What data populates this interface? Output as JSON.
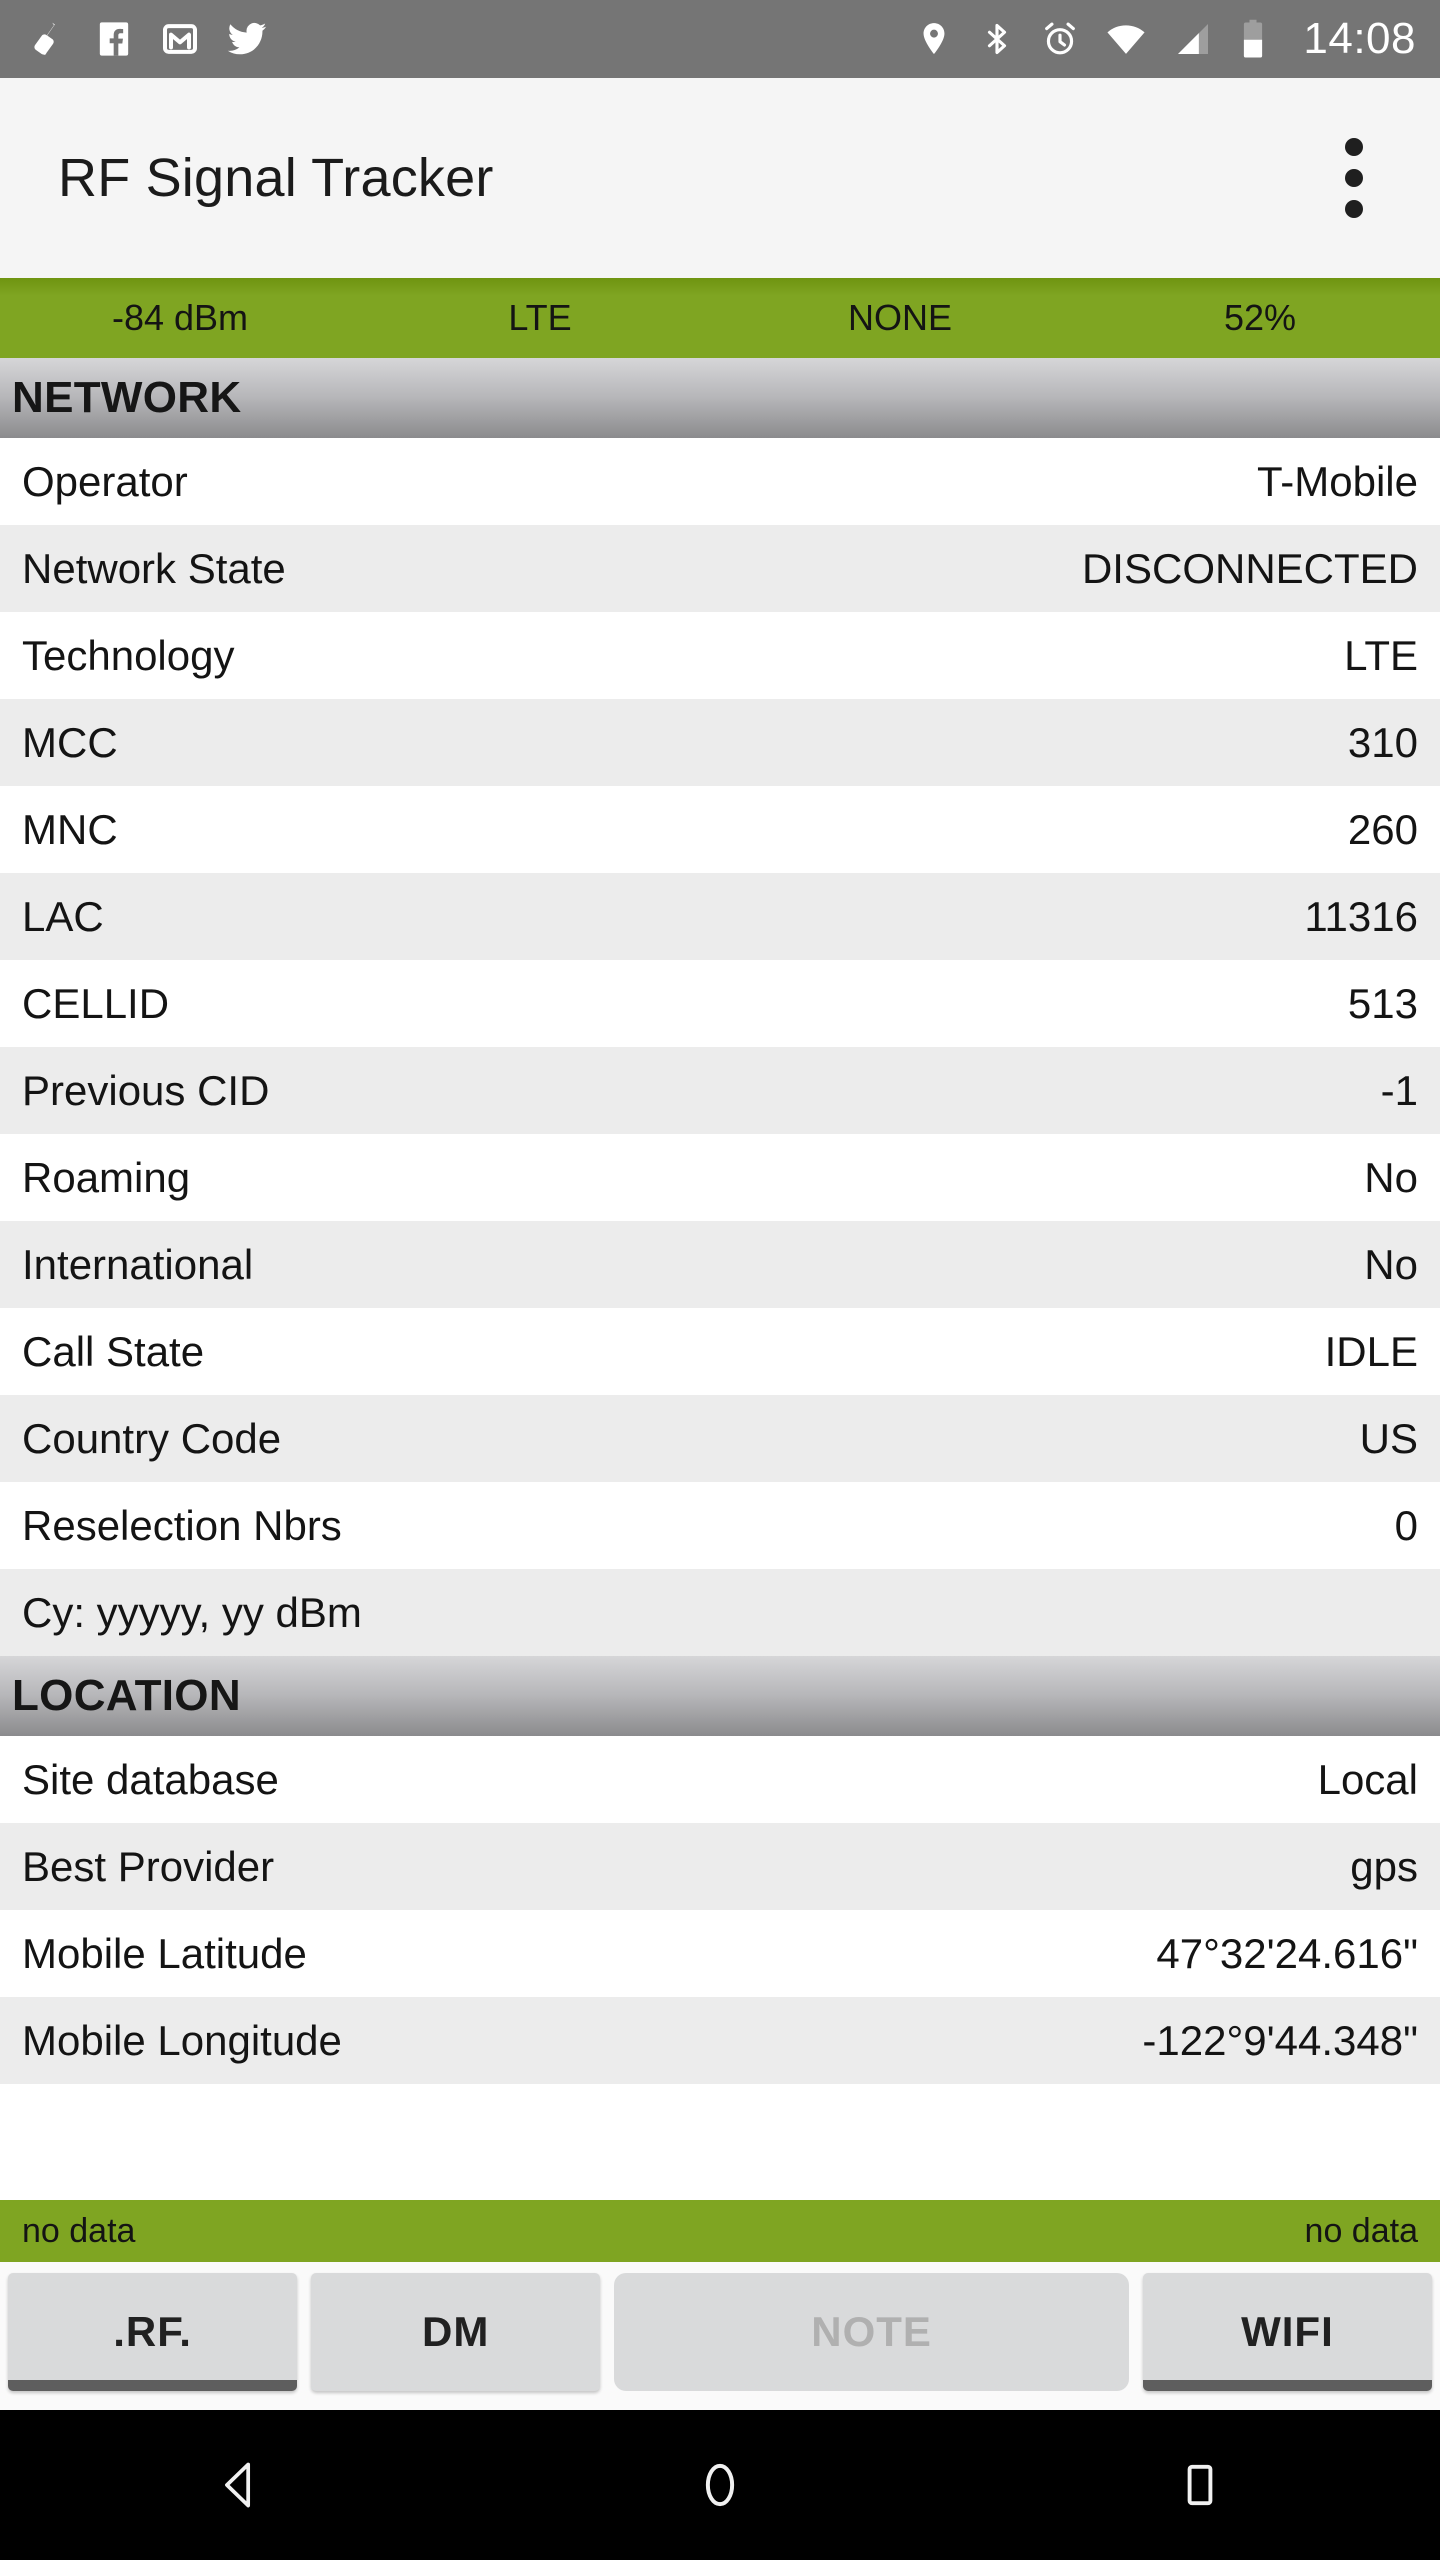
{
  "statusbar": {
    "left_icons": [
      "cleaner-icon",
      "facebook-icon",
      "gmail-icon",
      "twitter-icon"
    ],
    "right_icons": [
      "location-icon",
      "bluetooth-icon",
      "alarm-icon",
      "wifi-icon",
      "cellular-signal-icon",
      "battery-icon"
    ],
    "clock": "14:08",
    "background": "#757575"
  },
  "appbar": {
    "title": "RF Signal Tracker",
    "overflow_label": "More options",
    "background": "#f5f5f5"
  },
  "summary": {
    "accent": "#7fa522",
    "cells": [
      "-84 dBm",
      "LTE",
      "NONE",
      "52%"
    ]
  },
  "sections": [
    {
      "title": "NETWORK",
      "rows": [
        {
          "key": "Operator",
          "value": "T-Mobile"
        },
        {
          "key": "Network State",
          "value": "DISCONNECTED"
        },
        {
          "key": "Technology",
          "value": "LTE"
        },
        {
          "key": "MCC",
          "value": "310"
        },
        {
          "key": "MNC",
          "value": "260"
        },
        {
          "key": "LAC",
          "value": "11316"
        },
        {
          "key": "CELLID",
          "value": "513"
        },
        {
          "key": "Previous CID",
          "value": "-1"
        },
        {
          "key": "Roaming",
          "value": "No"
        },
        {
          "key": "International",
          "value": "No"
        },
        {
          "key": "Call State",
          "value": "IDLE"
        },
        {
          "key": "Country Code",
          "value": "US"
        },
        {
          "key": "Reselection Nbrs",
          "value": "0"
        },
        {
          "key": "Cy: yyyyy, yy dBm",
          "value": ""
        }
      ]
    },
    {
      "title": "LOCATION",
      "rows": [
        {
          "key": "Site database",
          "value": "Local"
        },
        {
          "key": "Best Provider",
          "value": "gps"
        },
        {
          "key": "Mobile Latitude",
          "value": "47°32'24.616\""
        },
        {
          "key": "Mobile Longitude",
          "value": "-122°9'44.348\""
        },
        {
          "key": "",
          "value": ""
        }
      ]
    }
  ],
  "footer": {
    "left": "no data",
    "right": "no data",
    "background": "#7fa522"
  },
  "tabs": [
    {
      "label": ".RF.",
      "state": "selected"
    },
    {
      "label": "DM",
      "state": "normal"
    },
    {
      "label": "NOTE",
      "state": "disabled"
    },
    {
      "label": "WIFI",
      "state": "selected"
    }
  ],
  "navbar": {
    "back": "back-icon",
    "home": "home-icon",
    "recents": "recents-icon"
  }
}
